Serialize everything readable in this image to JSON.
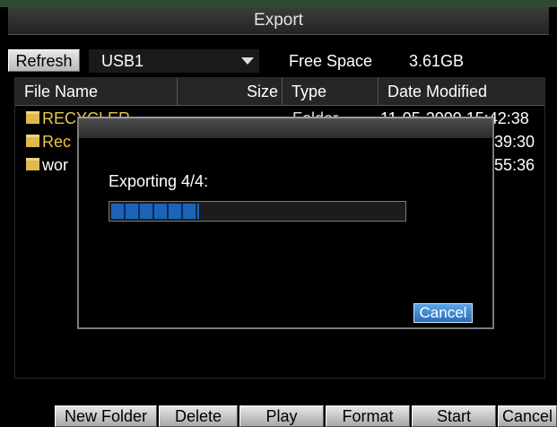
{
  "window": {
    "title": "Export"
  },
  "device": {
    "refresh_label": "Refresh",
    "selected_device": "USB1",
    "free_space_label": "Free Space",
    "free_space_value": "3.61GB"
  },
  "file_table": {
    "headers": {
      "name": "File Name",
      "size": "Size",
      "type": "Type",
      "date": "Date Modified"
    },
    "rows": [
      {
        "name": "RECYCLER",
        "type": "Folder",
        "date": "11-05-2009 15:42:38"
      },
      {
        "name": "Rec",
        "date": "39:30"
      },
      {
        "name": "wor",
        "date": "55:36"
      }
    ]
  },
  "dialog": {
    "message": "Exporting 4/4:",
    "progress": 0.3,
    "cancel_label": "Cancel"
  },
  "toolbar": {
    "new_folder": "New Folder",
    "delete": "Delete",
    "play": "Play",
    "format": "Format",
    "start": "Start",
    "cancel": "Cancel"
  }
}
